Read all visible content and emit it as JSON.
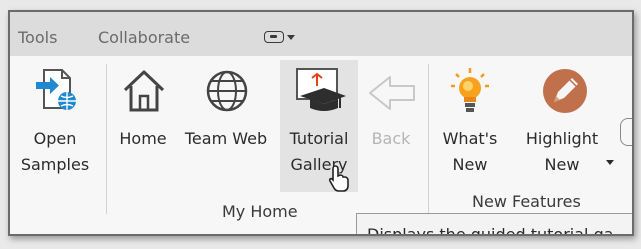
{
  "menu": {
    "tools": "Tools",
    "collaborate": "Collaborate"
  },
  "ribbon": {
    "open_samples": "Open\nSamples",
    "home": "Home",
    "team_web": "Team Web",
    "tutorial_gallery": "Tutorial\nGallery",
    "back": "Back",
    "whats_new": "What's\nNew",
    "highlight_new": "Highlight\nNew"
  },
  "groups": {
    "my_home": "My Home",
    "new_features": "New Features"
  },
  "tooltip": {
    "text": "Displays the guided tutorial ga"
  },
  "colors": {
    "accent_blue": "#1e88d2",
    "bulb_orange": "#f39a1e",
    "highlight_brown": "#c0704a"
  }
}
